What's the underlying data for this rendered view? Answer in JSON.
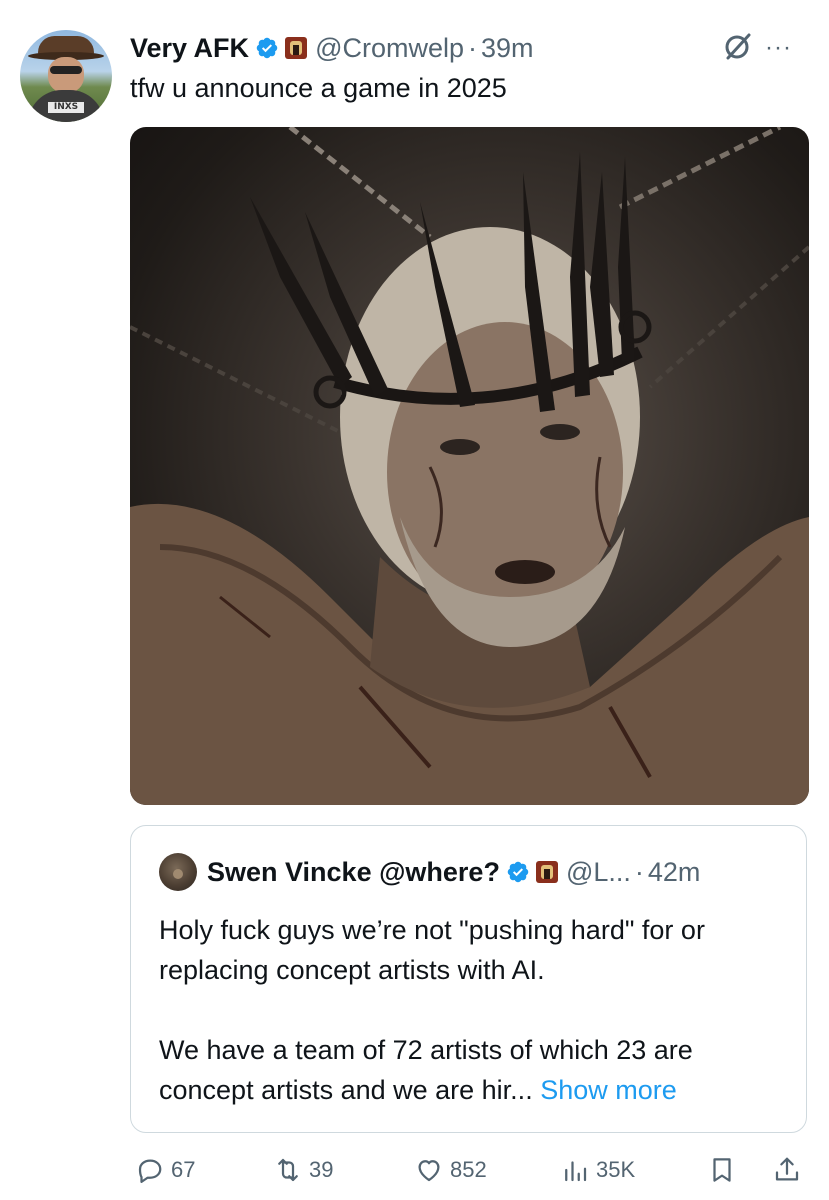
{
  "tweet": {
    "author": {
      "display_name": "Very AFK",
      "handle": "@Cromwelp",
      "timestamp": "39m",
      "separator": "·"
    },
    "text": "tfw u announce a game in 2025",
    "more_label": "···",
    "icons": {
      "verified": "verified-badge-icon",
      "affiliate": "affiliate-badge-icon",
      "grok": "grok-icon"
    }
  },
  "quote": {
    "author": {
      "display_name": "Swen Vincke @where?",
      "handle": "@L...",
      "timestamp": "42m",
      "separator": "·"
    },
    "paragraph1": "Holy fuck guys we’re not \"pushing hard\" for or replacing concept artists with AI.",
    "paragraph2": "We have a team of 72 artists of which 23 are concept artists and we are hir...",
    "show_more": "Show more"
  },
  "actions": {
    "replies": "67",
    "retweets": "39",
    "likes": "852",
    "views": "35K"
  },
  "colors": {
    "text": "#0f1419",
    "secondary": "#536471",
    "link": "#1d9bf0",
    "verified": "#1d9bf0",
    "border": "#cfd9de"
  }
}
